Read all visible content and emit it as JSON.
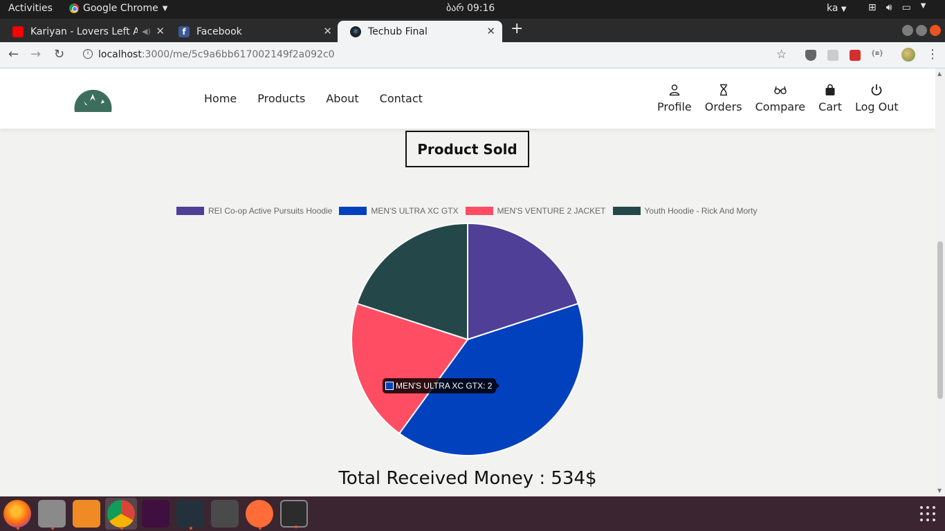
{
  "topbar": {
    "activities": "Activities",
    "app_name": "Google Chrome",
    "clock": "ბარ 09:16",
    "lang": "ka"
  },
  "tabs": [
    {
      "label": "Kariyan - Lovers Left A"
    },
    {
      "label": "Facebook"
    },
    {
      "label": "Techub Final"
    }
  ],
  "address": {
    "host": "localhost",
    "path": ":3000/me/5c9a6bb617002149f2a092c0"
  },
  "nav": {
    "main": [
      "Home",
      "Products",
      "About",
      "Contact"
    ],
    "user": [
      "Profile",
      "Orders",
      "Compare",
      "Cart",
      "Log Out"
    ]
  },
  "section_title": "Product Sold",
  "chart_data": {
    "type": "pie",
    "title": "",
    "categories": [
      "REI Co-op Active Pursuits Hoodie",
      "MEN'S ULTRA XC GTX",
      "MEN'S VENTURE 2 JACKET",
      "Youth Hoodie - Rick And Morty"
    ],
    "values": [
      1,
      2,
      1,
      1
    ],
    "colors": [
      "#4f3f96",
      "#0141be",
      "#ff4d63",
      "#24484a"
    ],
    "legend": "top",
    "tooltip": "MEN'S ULTRA XC GTX: 2"
  },
  "total_text": "Total Received Money : 534$",
  "colors": {
    "brand_green": "#3d6e5d",
    "ubuntu_orange": "#e95420"
  },
  "dock": [
    "firefox-icon",
    "files-icon",
    "software-icon",
    "chrome-icon",
    "slack-icon",
    "vscode-icon",
    "sublime-icon",
    "postman-icon",
    "terminal-icon"
  ]
}
